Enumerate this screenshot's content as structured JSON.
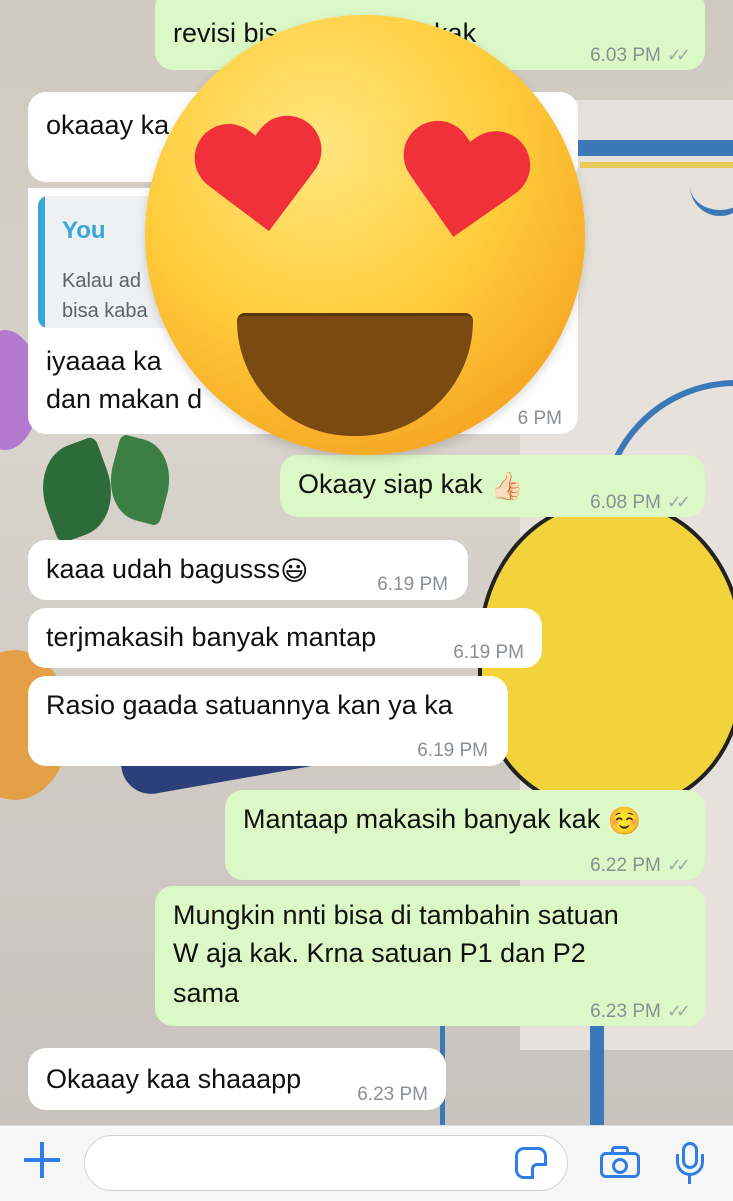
{
  "messages": [
    {
      "id": "m1",
      "dir": "out",
      "text": "revisi bis",
      "text_tail": "ya kak",
      "time": "6.03 PM",
      "ticks": "✓✓"
    },
    {
      "id": "m2",
      "dir": "in",
      "text": "okaaay ka"
    },
    {
      "id": "m3",
      "dir": "in",
      "quote": {
        "author": "You",
        "line1": "Kalau ad",
        "line2": "bisa kaba"
      },
      "line1": "iyaaaa ka",
      "line2": "dan makan d",
      "time": "6 PM"
    },
    {
      "id": "m4",
      "dir": "out",
      "text": "Okaay siap kak",
      "emoji": "👍🏻",
      "time": "6.08 PM",
      "ticks": "✓✓"
    },
    {
      "id": "m5",
      "dir": "in",
      "text": "kaaa udah bagusss",
      "emoji": "😃",
      "time": "6.19 PM"
    },
    {
      "id": "m6",
      "dir": "in",
      "text": "terjmakasih banyak mantap",
      "time": "6.19 PM"
    },
    {
      "id": "m7",
      "dir": "in",
      "text": "Rasio gaada satuannya kan ya ka",
      "time": "6.19 PM"
    },
    {
      "id": "m8",
      "dir": "out",
      "text": "Mantaap makasih banyak kak",
      "emoji": "☺️",
      "time": "6.22 PM",
      "ticks": "✓✓"
    },
    {
      "id": "m9",
      "dir": "out",
      "line1": "Mungkin nnti bisa di tambahin satuan",
      "line2": "W aja kak. Krna satuan P1 dan P2",
      "line3": "sama",
      "time": "6.23 PM",
      "ticks": "✓✓"
    },
    {
      "id": "m10",
      "dir": "in",
      "text": "Okaaay kaa shaaapp",
      "time": "6.23 PM"
    }
  ],
  "overlay": {
    "icon": "heart-eyes-emoji-icon"
  },
  "input_bar": {
    "placeholder": "",
    "icons": [
      "plus-icon",
      "sticker-icon",
      "camera-icon",
      "microphone-icon"
    ],
    "accent": "#2f7ee8"
  },
  "colors": {
    "incoming": "#ffffff",
    "outgoing": "#dcf8c6",
    "quote_accent": "#35a7da"
  }
}
